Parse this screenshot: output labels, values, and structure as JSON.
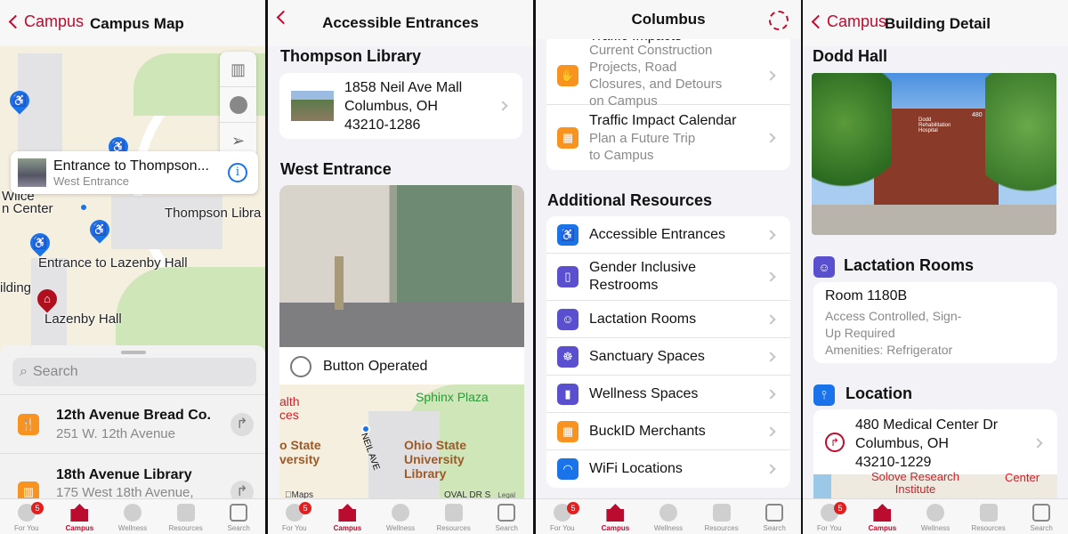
{
  "tabbar": {
    "items": [
      "For You",
      "Campus",
      "Wellness",
      "Resources",
      "Search"
    ],
    "badge": "5"
  },
  "colors": {
    "brand": "#ba0c2f",
    "orange": "#f7931e",
    "purple": "#5a4fcf",
    "blue": "#1a73e8"
  },
  "screen1": {
    "back": "Campus",
    "title": "Campus Map",
    "map_labels": [
      "Entrance to Lazenby Hall",
      "Lazenby Hall",
      "Thompson Libra",
      "Wilce",
      "n Center",
      "ilding"
    ],
    "callout": {
      "title": "Entrance to Thompson...",
      "subtitle": "West Entrance"
    },
    "controls": [
      "map-icon",
      "filter-icon",
      "location-arrow-icon"
    ],
    "search_placeholder": "Search",
    "list": [
      {
        "title": "12th Avenue Bread Co.",
        "subtitle": "251 W. 12th Avenue",
        "icon": "fork-knife-icon"
      },
      {
        "title": "18th Avenue Library",
        "subtitle": "175 West 18th Avenue,",
        "icon": "books-icon"
      }
    ]
  },
  "screen2": {
    "title": "Accessible Entrances",
    "building": "Thompson Library",
    "address": [
      "1858 Neil Ave Mall",
      "Columbus, OH",
      "43210-1286"
    ],
    "entrance": "West Entrance",
    "feature": "Button Operated",
    "map_labels": {
      "plaza": "Sphinx Plaza",
      "library": "Ohio State University Library",
      "left1": "alth",
      "left2": "ces",
      "left3": "o State",
      "left4": "versity",
      "street": "NEIL AVE",
      "maps": "Maps",
      "legal": "Legal",
      "oval": "OVAL DR S"
    }
  },
  "screen3": {
    "title": "Columbus",
    "top_rows": [
      {
        "title": "Traffic Impacts",
        "subtitle": "Current Construction Projects, Road Closures, and Detours on Campus"
      },
      {
        "title": "Traffic Impact Calendar",
        "subtitle": "Plan a Future Trip to Campus"
      }
    ],
    "section": "Additional Resources",
    "resources": [
      {
        "label": "Accessible Entrances",
        "icon": "wheelchair-icon",
        "color": "#1a73e8",
        "glyph": "♿"
      },
      {
        "label": "Gender Inclusive Restrooms",
        "icon": "toilet-icon",
        "color": "#5a4fcf",
        "glyph": "▯"
      },
      {
        "label": "Lactation Rooms",
        "icon": "lactation-icon",
        "color": "#5a4fcf",
        "glyph": "☺"
      },
      {
        "label": "Sanctuary Spaces",
        "icon": "meditation-icon",
        "color": "#5a4fcf",
        "glyph": "☸"
      },
      {
        "label": "Wellness Spaces",
        "icon": "wellness-door-icon",
        "color": "#5a4fcf",
        "glyph": "▮"
      },
      {
        "label": "BuckID Merchants",
        "icon": "store-icon",
        "color": "#f7931e",
        "glyph": "▦"
      },
      {
        "label": "WiFi Locations",
        "icon": "wifi-icon",
        "color": "#1a73e8",
        "glyph": "◠"
      }
    ]
  },
  "screen4": {
    "back": "Campus",
    "title": "Building Detail",
    "building": "Dodd Hall",
    "sign": "Dodd Rehabilitation Hospital",
    "sign_num": "480",
    "lactation": {
      "header": "Lactation Rooms",
      "room": "Room 1180B",
      "details": [
        "Access Controlled, Sign-",
        "Up Required",
        "Amenities: Refrigerator"
      ]
    },
    "location": {
      "header": "Location",
      "address": [
        "480 Medical Center Dr",
        "Columbus, OH",
        "43210-1229"
      ]
    },
    "map_labels": {
      "a": "Solove Research",
      "b": "Institute",
      "c": "Center"
    }
  }
}
